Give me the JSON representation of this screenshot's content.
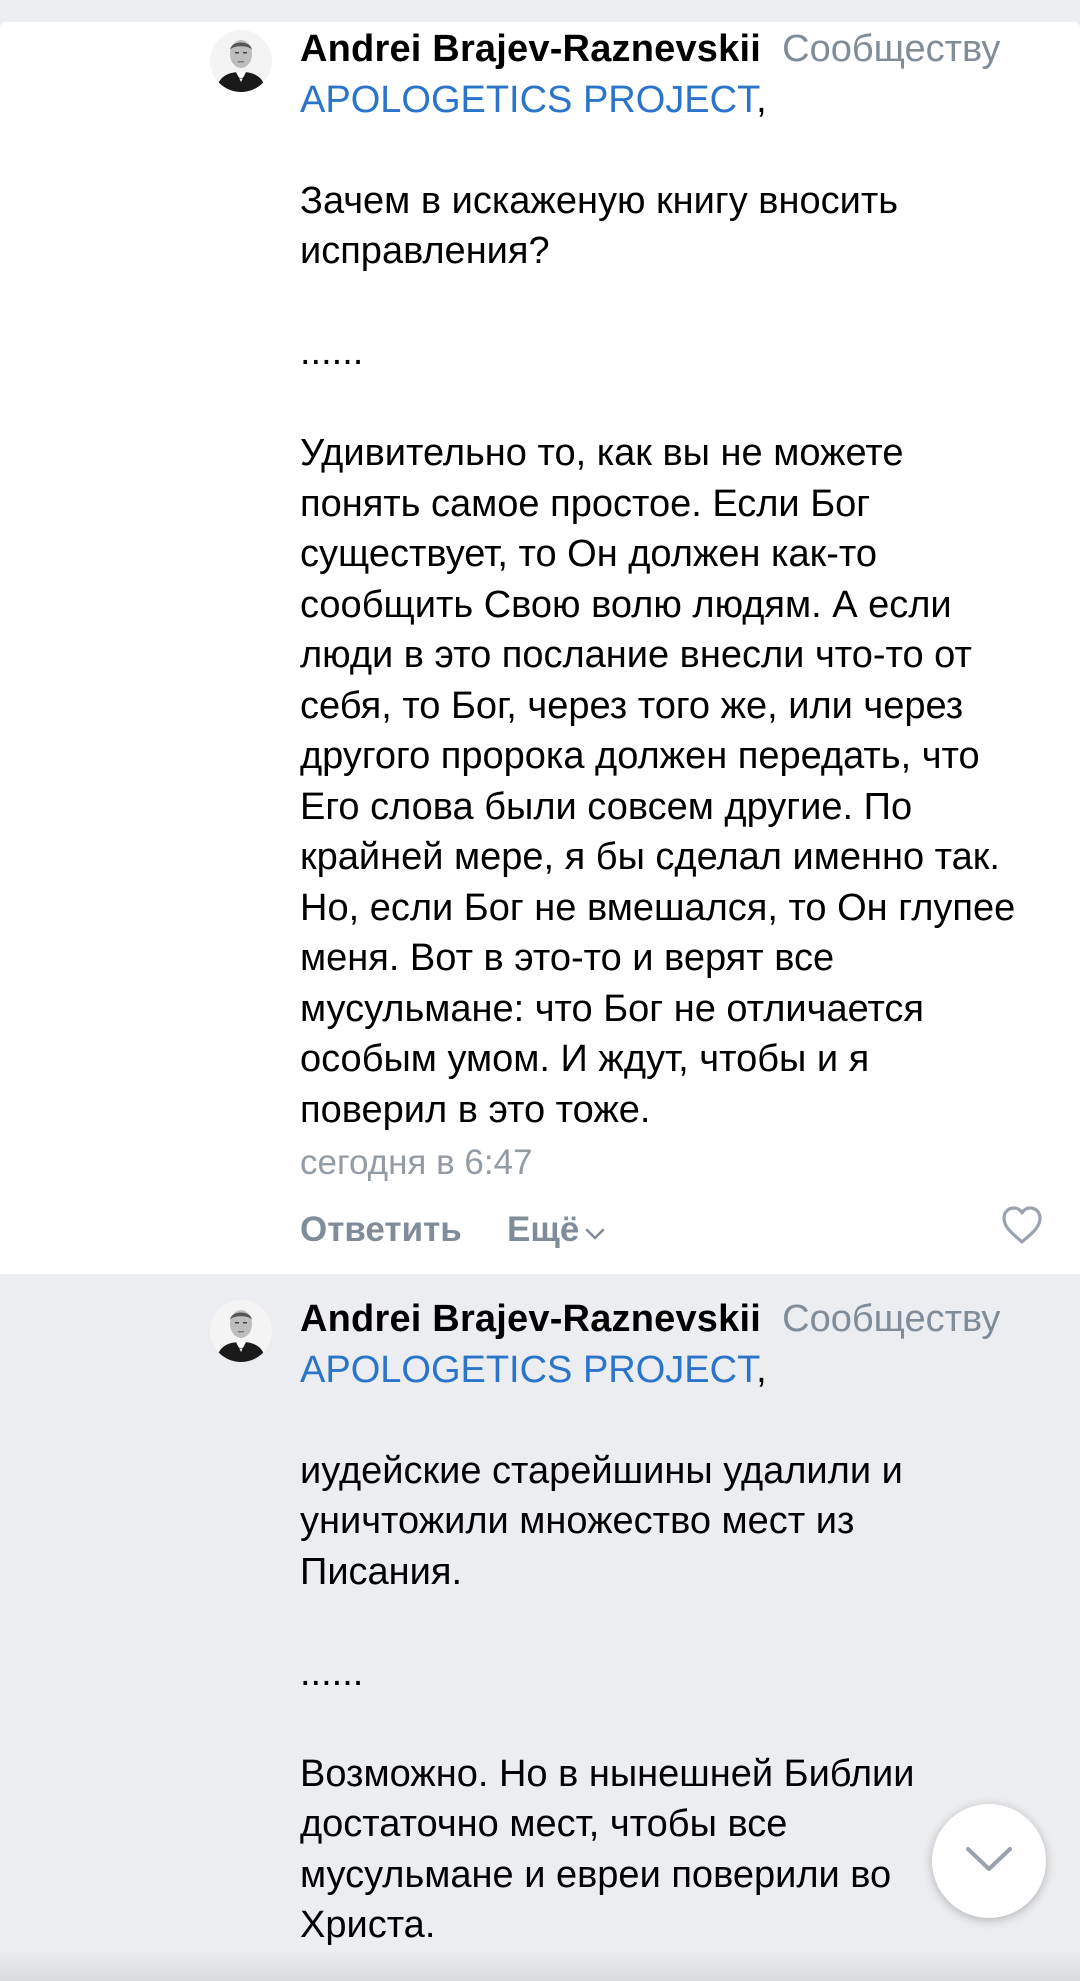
{
  "comments": [
    {
      "author": "Andrei Brajev-Raznevskii",
      "reply_to_label": "Сообществу",
      "mention": "APOLOGETICS PROJECT",
      "mention_suffix": ",",
      "paragraphs": [
        "Зачем в искаженую книгу вносить\nисправления?",
        "......",
        "Удивительно то, как вы не можете\nпонять самое простое. Если Бог\nсуществует, то Он должен как-то\nсообщить Свою волю людям. А если\nлюди в это послание внесли что-то от\nсебя, то Бог, через того же, или через\nдругого пророка должен передать, что\nЕго слова были совсем другие. По\nкрайней мере, я бы сделал именно так.\nНо, если Бог не вмешался, то Он глупее\nменя. Вот в это-то и верят все\nмусульмане: что Бог не отличается\nособым умом. И ждут, чтобы и я\nповерил в это тоже."
      ],
      "timestamp": "сегодня в 6:47",
      "reply_label": "Ответить",
      "more_label": "Ещё"
    },
    {
      "author": "Andrei Brajev-Raznevskii",
      "reply_to_label": "Сообществу",
      "mention": "APOLOGETICS PROJECT",
      "mention_suffix": ",",
      "paragraphs": [
        "иудейские старейшины удалили и\nуничтожили множество мест из\nПисания.",
        "......",
        "Возможно. Но в нынешней Библии\nдостаточно мест, чтобы все\nмусульмане и евреи поверили во\nХриста."
      ]
    }
  ],
  "icons": {
    "like": "heart-outline-icon",
    "more": "chevron-down-icon",
    "scroll": "chevron-down-icon"
  },
  "colors": {
    "link": "#2a74c9",
    "secondary": "#818c99",
    "timestamp": "#939ba4",
    "highlight_bg": "#ebedf0"
  }
}
